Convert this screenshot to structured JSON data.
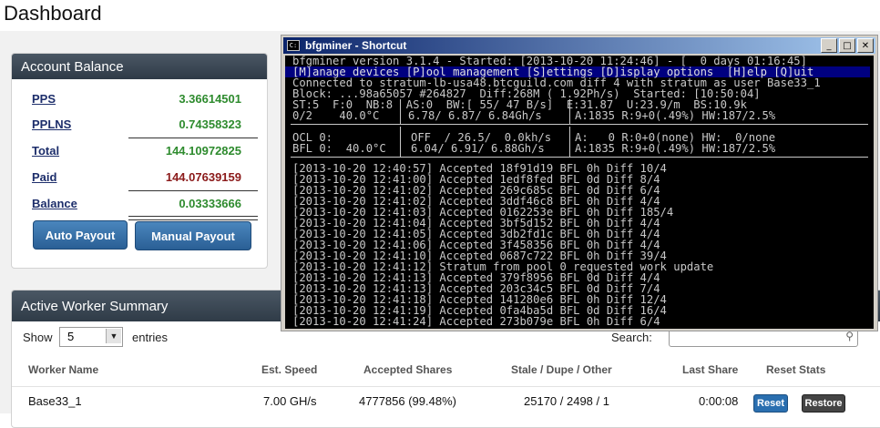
{
  "page": {
    "title": "Dashboard"
  },
  "account_balance": {
    "title": "Account Balance",
    "rows": [
      {
        "label": "PPS",
        "value": "3.36614501"
      },
      {
        "label": "PPLNS",
        "value": "0.74358323"
      },
      {
        "label": "Total",
        "value": "144.10972825"
      },
      {
        "label": "Paid",
        "value": "144.07639159"
      },
      {
        "label": "Balance",
        "value": "0.03333666"
      }
    ],
    "auto_payout_label": "Auto Payout",
    "manual_payout_label": "Manual Payout",
    "colors": {
      "positive": "#2e8b2e",
      "paid": "#8b1a1a"
    }
  },
  "worker_summary": {
    "title": "Active Worker Summary",
    "show_label": "Show",
    "entries_value": "5",
    "entries_label": "entries",
    "search_label": "Search:",
    "search_value": "",
    "columns": [
      "Worker Name",
      "Est. Speed",
      "Accepted Shares",
      "Stale / Dupe / Other",
      "Last Share",
      "Reset Stats"
    ],
    "rows": [
      {
        "name": "Base33_1",
        "speed": "7.00 GH/s",
        "accepted": "4777856 (99.48%)",
        "stale": "25170 / 2498 / 1",
        "last_share": "0:00:08",
        "reset_label": "Reset",
        "restore_label": "Restore"
      }
    ]
  },
  "console_window": {
    "title": "bfgminer - Shortcut",
    "lines": {
      "header": "bfgminer version 3.1.4 - Started: [2013-10-20 11:24:46] - [  0 days 01:16:45]",
      "menu": "[M]anage devices [P]ool management [S]ettings [D]isplay options  [H]elp [Q]uit",
      "connected": "Connected to stratum-lb-usa48.btcguild.com diff 4 with stratum as user Base33_1",
      "block": "Block: ...98a65057 #264827  Diff:268M ( 1.92Ph/s)  Started: [10:50:04]",
      "stats": "ST:5  F:0  NB:8  AS:0  BW:[ 55/ 47 B/s]  E:31.87  U:23.9/m  BS:10.9k",
      "summary_dev": "0/2    40.0°C",
      "summary_rate": "6.78/ 6.87/ 6.84Gh/s",
      "summary_accept": "A:1835 R:9+0(.49%) HW:187/2.5%",
      "ocl_dev": "OCL 0:",
      "ocl_rate": "OFF  / 26.5/  0.0kh/s",
      "ocl_accept": "A:   0 R:0+0(none) HW:  0/none",
      "bfl_dev": "BFL 0:  40.0°C",
      "bfl_rate": "6.04/ 6.91/ 6.88Gh/s",
      "bfl_accept": "A:1835 R:9+0(.49%) HW:187/2.5%"
    },
    "log": [
      "[2013-10-20 12:40:57] Accepted 18f91d19 BFL 0h Diff 10/4",
      "[2013-10-20 12:41:00] Accepted 1edf8fed BFL 0d Diff 8/4",
      "[2013-10-20 12:41:02] Accepted 269c685c BFL 0d Diff 6/4",
      "[2013-10-20 12:41:02] Accepted 3ddf46c8 BFL 0h Diff 4/4",
      "[2013-10-20 12:41:03] Accepted 0162253e BFL 0h Diff 185/4",
      "[2013-10-20 12:41:04] Accepted 3bf5d152 BFL 0h Diff 4/4",
      "[2013-10-20 12:41:05] Accepted 3db2fd1c BFL 0h Diff 4/4",
      "[2013-10-20 12:41:06] Accepted 3f458356 BFL 0h Diff 4/4",
      "[2013-10-20 12:41:10] Accepted 0687c722 BFL 0h Diff 39/4",
      "[2013-10-20 12:41:12] Stratum from pool 0 requested work update",
      "[2013-10-20 12:41:13] Accepted 379f8956 BFL 0d Diff 4/4",
      "[2013-10-20 12:41:13] Accepted 203c34c5 BFL 0d Diff 7/4",
      "[2013-10-20 12:41:18] Accepted 141280e6 BFL 0h Diff 12/4",
      "[2013-10-20 12:41:19] Accepted 0fa4ba5d BFL 0d Diff 16/4",
      "[2013-10-20 12:41:24] Accepted 273b079e BFL 0h Diff 6/4"
    ]
  }
}
